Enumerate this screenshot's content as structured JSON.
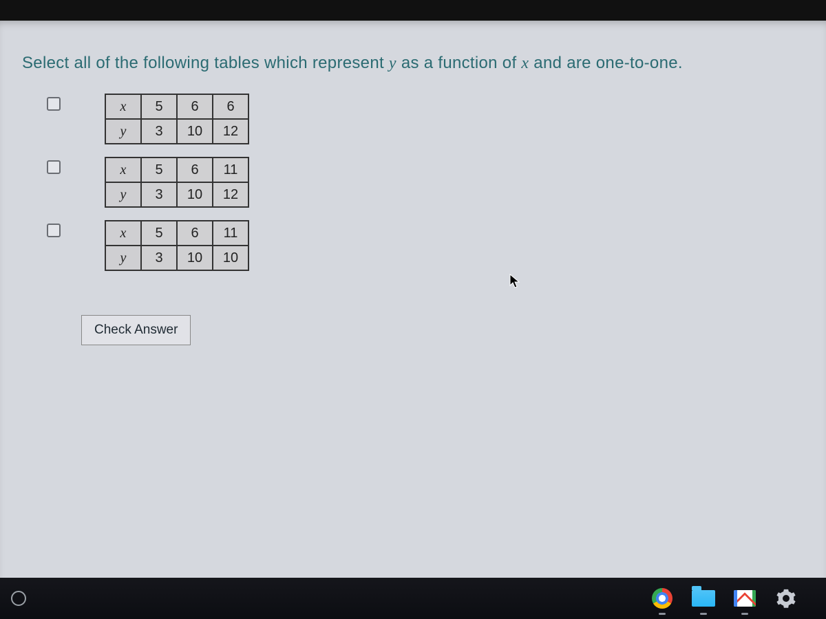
{
  "prompt": {
    "pre": "Select all of the following tables which represent ",
    "var1": "y",
    "mid": " as a function of ",
    "var2": "x",
    "post": " and are one-to-one."
  },
  "tables": [
    {
      "rows": [
        {
          "label": "x",
          "cells": [
            "5",
            "6",
            "6"
          ]
        },
        {
          "label": "y",
          "cells": [
            "3",
            "10",
            "12"
          ]
        }
      ]
    },
    {
      "rows": [
        {
          "label": "x",
          "cells": [
            "5",
            "6",
            "11"
          ]
        },
        {
          "label": "y",
          "cells": [
            "3",
            "10",
            "12"
          ]
        }
      ]
    },
    {
      "rows": [
        {
          "label": "x",
          "cells": [
            "5",
            "6",
            "11"
          ]
        },
        {
          "label": "y",
          "cells": [
            "3",
            "10",
            "10"
          ]
        }
      ]
    }
  ],
  "button": {
    "check": "Check Answer"
  },
  "taskbar": {
    "apps": [
      "chrome",
      "file-explorer",
      "gmail",
      "settings"
    ]
  }
}
